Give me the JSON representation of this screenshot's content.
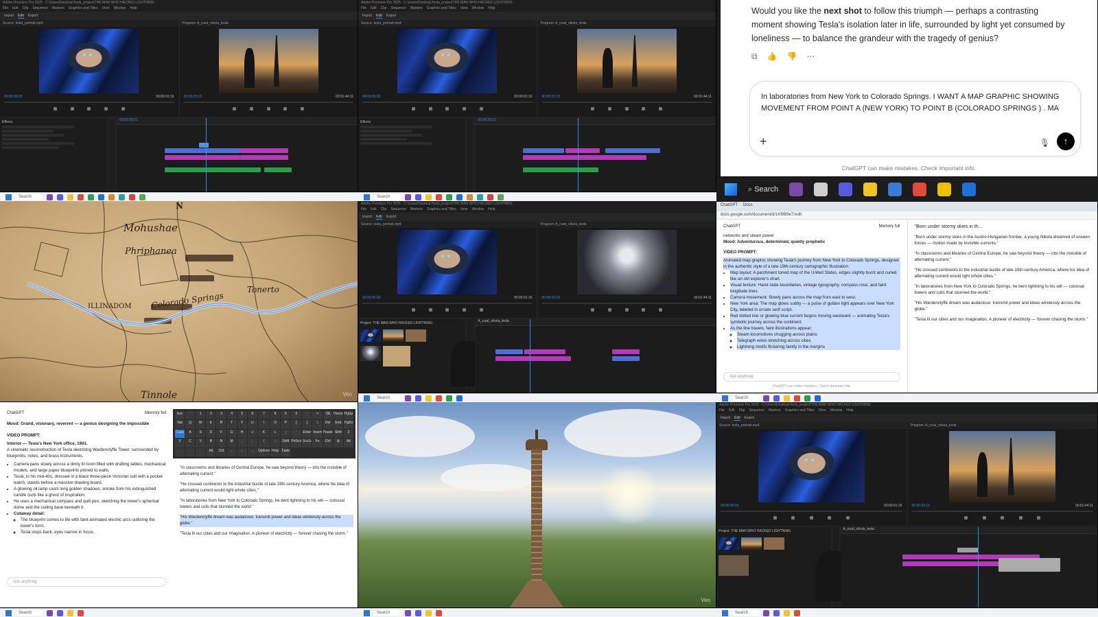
{
  "premiere": {
    "title": "Adobe Premiere Pro 2025 - C:\\Users\\Desktop\\Tesla_project\\THE MAN WHO HACKED LIGHTNING",
    "menu": [
      "File",
      "Edit",
      "Clip",
      "Sequence",
      "Markers",
      "Graphics and Titles",
      "View",
      "Window",
      "Help"
    ],
    "workspace": [
      "Import",
      "Edit",
      "Export"
    ],
    "source_tab": "Source: tesla_portrait.mp4",
    "program_tab": "Program: A_rural_nikola_tesla",
    "tc_left": "00:00:06:03",
    "tc_right": "00:00:01:16",
    "tc_prog_left": "00:00:23:13",
    "tc_prog_right": "00:01:44:11",
    "project_label": "Project: THE MAN WHO HACKED LIGHTNING",
    "effects_label": "Effects",
    "sequence_label": "A_rural_nikola_tesla",
    "seq_tc": "00:00:25:21"
  },
  "chatgpt": {
    "message_pre": "Would you like the ",
    "message_bold": "next shot",
    "message_post": " to follow this triumph — perhaps a contrasting moment showing Tesla's isolation later in life, surrounded by light yet consumed by loneliness — to balance the grandeur with the tragedy of genius?",
    "actions": [
      "⧉",
      "👍",
      "👎",
      "⋯"
    ],
    "composer_text": "In laboratories from New York to Colorado Springs. I WANT A MAP GRAPHIC SHOWING MOVEMENT FROM POINT A (NEW YORK) TO POINT B (COLORADO SPRINGS ) . MA",
    "disclaimer": "ChatGPT can make mistakes. Check important info.",
    "send_icon": "↑",
    "plus_icon": "+",
    "mic_icon": "🎙"
  },
  "taskbar_big": {
    "search_label": "Search",
    "app_colors": [
      "#7b4aa8",
      "#cfcfcf",
      "#5a5ae0",
      "#f3c32b",
      "#3a7bd5",
      "#e04a3a",
      "#f0c000",
      "#1e6fd6",
      "#2e9e4f"
    ]
  },
  "taskbar_small": {
    "search_label": "Search",
    "app_colors": [
      "#7b4aa8",
      "#888",
      "#5a5ae0",
      "#f3c32b",
      "#3a7bd5",
      "#e04a3a",
      "#2e9e4f",
      "#1e6fd6",
      "#d98a2a",
      "#2aa0a0",
      "#c44",
      "#5a5"
    ]
  },
  "map": {
    "labels": [
      "Mohushae",
      "Phriphanea",
      "Colorado Springs",
      "Tonerto",
      "ILLINADOM",
      "Tinnole",
      "N"
    ],
    "watermark": "Veo"
  },
  "landscape": {
    "watermark": "Veo"
  },
  "split_chat": {
    "tabs": [
      "ChatGPT",
      "Docs"
    ],
    "url": "docs.google.com/document/d/1Kf8B9eT/edit",
    "header": "ChatGPT",
    "memory": "Memory full",
    "intro": "networks and steam power",
    "mood": "Mood: Adventurous, determined, quietly prophetic",
    "prompt_heading": "VIDEO PROMPT:",
    "lines": [
      "Animated map graphic showing Tesla's journey from New York to Colorado Springs, designed in the authentic style of a late-19th-century cartographic illustration.",
      "Map layout: A parchment toned map of the United States, edges slightly burnt and curled like an old explorer's chart.",
      "Visual texture: Hand state boundaries, vintage typography, compass rose, and faint longitude lines.",
      "Camera movement: Slowly pans across the map from east to west.",
      "New York area: The map glows subtly — a pulse of golden light appears over New York City, labeled in ornate serif script.",
      "Red dotted line or glowing blue current begins moving westward — animating Tesla's symbolic journey across the continent.",
      "As the line travels, faint illustrations appear:",
      "Steam locomotives chugging across plains",
      "Telegraph wires stretching across cities",
      "Lightning motifs flickering faintly in the margins"
    ],
    "ask": "Ask anything",
    "foot": "ChatGPT can make mistakes. Check important info.",
    "doc_title": "\"Born under stormy skies in th...",
    "doc_lines": [
      "\"Born under stormy skies in the Austro-Hungarian frontier, a young Nikola dreamed of unseen forces — motion made by invisible currents.\"",
      "\"In classrooms and libraries of Central Europe, he saw beyond theory — into the invisible of alternating current.\"",
      "\"He crossed continents to the industrial bustle of late-19th-century America, where his idea of alternating current would light whole cities.\"",
      "\"In laboratories from New York to Colorado Springs, he bent lightning to his will — colossal towers and coils that stunned the world.\"",
      "\"His Wardenclyffe dream was audacious: transmit power and ideas wirelessly across the globe.\"",
      "\"Tesla lit our cities and our imagination. A pioneer of electricity — forever chasing the storm.\""
    ]
  },
  "bottom_left": {
    "header": "ChatGPT",
    "memory": "Memory full",
    "mood": "Mood: Grand, visionary, reverent — a genius designing the impossible",
    "prompt_heading": "VIDEO PROMPT:",
    "scene": "Interior — Tesla's New York office, 1901.",
    "lead": "A cinematic reconstruction of Tesla sketching Wardenclyffe Tower, surrounded by blueprints, notes, and brass instruments.",
    "bullets": [
      "Camera pans slowly across a dimly lit room filled with drafting tables, mechanical models, and large paper blueprints pinned to walls.",
      "Tesla, in his mid-40s, dressed in a black three-piece Victorian suit with a pocket watch, stands before a massive drawing board.",
      "A glowing oil lamp casts long golden shadows; smoke from his extinguished candle curls like a ghost of inspiration.",
      "He uses a mechanical compass and quill pen, sketching the tower's spherical dome and the coiling base beneath it.",
      "Cutaway detail:",
      "The blueprint comes to life with faint animated electric arcs outlining the tower's form.",
      "Tesla stops back, eyes narrow in focus."
    ],
    "ask": "Ask anything",
    "keys": [
      "Esc",
      "`",
      "1",
      "2",
      "3",
      "4",
      "5",
      "6",
      "7",
      "8",
      "9",
      "0",
      "-",
      "=",
      "⌫",
      "Home",
      "PgUp",
      "Tab",
      "Q",
      "W",
      "E",
      "R",
      "T",
      "Y",
      "U",
      "I",
      "O",
      "P",
      "[",
      "]",
      "\\",
      "Del",
      "End",
      "PgDn",
      "Caps",
      "A",
      "S",
      "D",
      "F",
      "G",
      "H",
      "J",
      "K",
      "L",
      ";",
      "'",
      "Enter",
      "Insert",
      "Pause",
      "Shift",
      "Z",
      "X",
      "C",
      "V",
      "B",
      "N",
      "M",
      ",",
      ".",
      "/",
      "↑",
      "Shift",
      "PrtScn",
      "ScrLk",
      "Fn",
      "Ctrl",
      "⊞",
      "Alt",
      "",
      "",
      "",
      "Alt",
      "Ctrl",
      "←",
      "↓",
      "→",
      "Options",
      "Help",
      "Fade"
    ],
    "doc_lines": [
      "\"In classrooms and libraries of Central Europe, he saw beyond theory — into the invisible of alternating current.\"",
      "\"He crossed continents to the industrial bustle of late-19th-century America, where his idea of alternating current would light whole cities.\"",
      "\"In laboratories from New York to Colorado Springs, he bent lightning to his will — colossal towers and coils that stunned the world.\"",
      "\"His Wardenclyffe dream was audacious: transmit power and ideas wirelessly across the globe.\"",
      "\"Tesla lit our cities and our imagination. A pioneer of electricity — forever chasing the storm.\""
    ]
  }
}
